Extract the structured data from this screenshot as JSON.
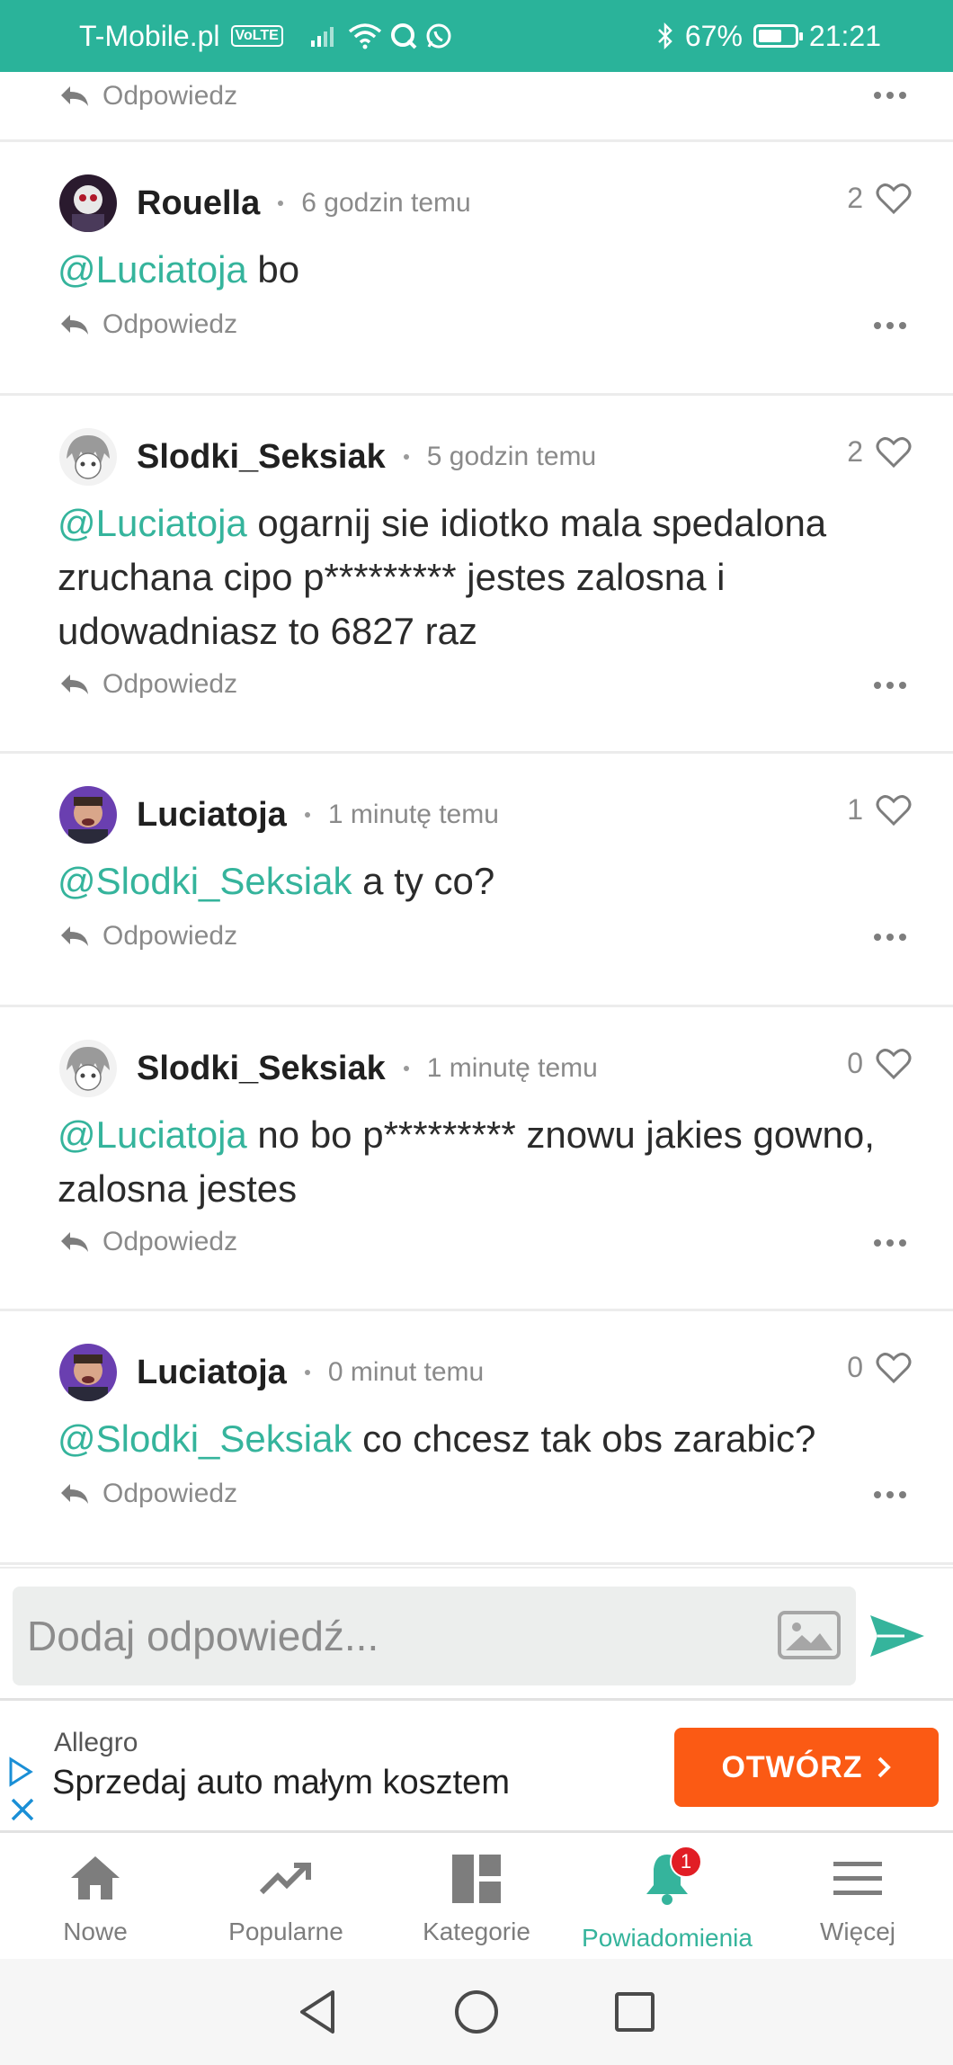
{
  "status_bar": {
    "carrier": "T-Mobile.pl",
    "volte": "VoLTE",
    "battery": "67%",
    "battery_level": 0.67,
    "time": "21:21"
  },
  "reply_label": "Odpowiedz",
  "comments": [
    {
      "username": "Rouella",
      "timestamp": "6 godzin temu",
      "likes": "2",
      "mention": "@Luciatoja",
      "text": " bo"
    },
    {
      "username": "Slodki_Seksiak",
      "timestamp": "5 godzin temu",
      "likes": "2",
      "mention": "@Luciatoja",
      "text": " ogarnij sie idiotko mala spedalona zruchana cipo p********* jestes zalosna i udowadniasz to 6827 raz"
    },
    {
      "username": "Luciatoja",
      "timestamp": "1 minutę temu",
      "likes": "1",
      "mention": "@Slodki_Seksiak",
      "text": " a ty co?"
    },
    {
      "username": "Slodki_Seksiak",
      "timestamp": "1 minutę temu",
      "likes": "0",
      "mention": "@Luciatoja",
      "text": " no bo p********* znowu jakies gowno, zalosna jestes"
    },
    {
      "username": "Luciatoja",
      "timestamp": "0 minut temu",
      "likes": "0",
      "mention": "@Slodki_Seksiak",
      "text": " co chcesz tak obs zarabic?"
    }
  ],
  "reply_input": {
    "placeholder": "Dodaj odpowiedź..."
  },
  "ad": {
    "advertiser": "Allegro",
    "headline": "Sprzedaj auto małym kosztem",
    "button": "OTWÓRZ"
  },
  "bottom_nav": {
    "items": [
      {
        "label": "Nowe",
        "icon": "home-icon"
      },
      {
        "label": "Popularne",
        "icon": "trending-icon"
      },
      {
        "label": "Kategorie",
        "icon": "grid-icon"
      },
      {
        "label": "Powiadomienia",
        "icon": "bell-icon",
        "active": true,
        "badge": "1"
      },
      {
        "label": "Więcej",
        "icon": "menu-icon"
      }
    ]
  },
  "colors": {
    "accent": "#35b49c",
    "status_bar": "#2ab39a",
    "ad_button": "#fb5a14",
    "badge": "#e11e25"
  }
}
